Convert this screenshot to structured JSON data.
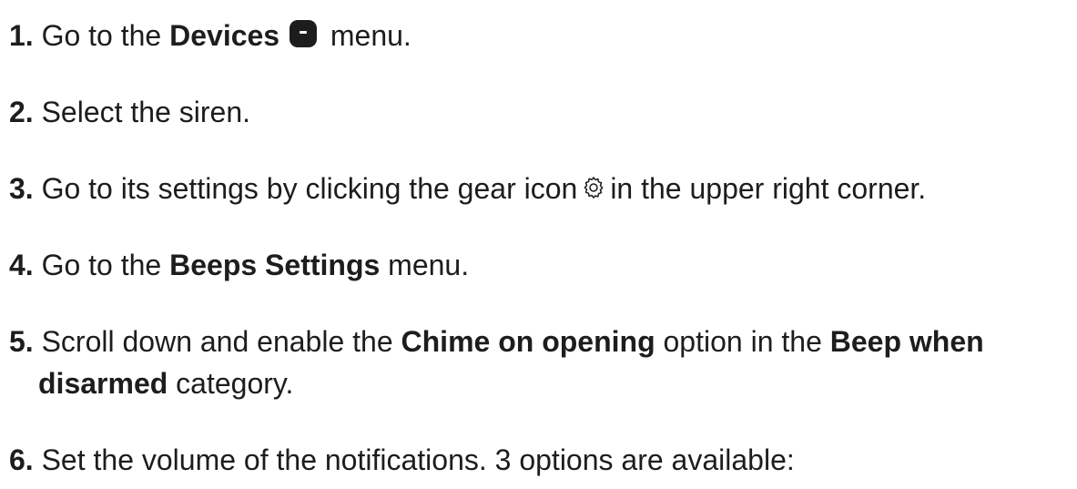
{
  "steps": [
    {
      "num": "1.",
      "t1": "Go to the ",
      "b1": "Devices",
      "t2": " menu.",
      "icon": "devices-icon"
    },
    {
      "num": "2.",
      "t1": "Select the siren."
    },
    {
      "num": "3.",
      "t1": "Go to its settings by clicking the gear icon",
      "t2": "in the upper right corner.",
      "icon": "gear-icon"
    },
    {
      "num": "4.",
      "t1": "Go to the ",
      "b1": "Beeps Settings",
      "t2": " menu."
    },
    {
      "num": "5.",
      "t1": "Scroll down and enable the ",
      "b1": "Chime on opening",
      "t2": " option in the ",
      "b2": "Beep when",
      "b3": "disarmed",
      "t3": " category."
    },
    {
      "num": "6.",
      "t1": "Set the volume of the notifications. 3 options are available:"
    }
  ]
}
